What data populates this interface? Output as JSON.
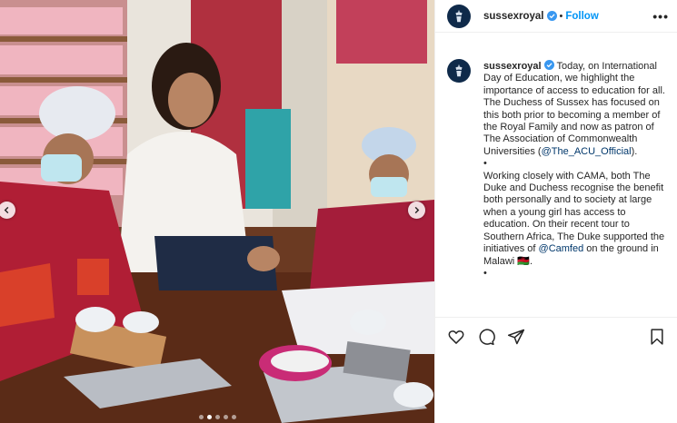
{
  "post": {
    "account": "sussexroyal",
    "follow_label": "Follow",
    "more_glyph": "•••",
    "separator": "•",
    "verified_icon": "verified-badge-icon",
    "accent_color": "#0095f6"
  },
  "caption": {
    "username": "sussexroyal",
    "p1_before": " Today, on International Day of Education, we highlight the importance of access to education for all. The Duchess of Sussex has focused on this both prior to becoming a member of the Royal Family and now as patron of The Association of Commonwealth Universities (",
    "p1_mention": "@The_ACU_Official",
    "p1_after": ").",
    "divider": "•",
    "p2_before": "Working closely with CAMA, both The Duke and Duchess recognise the benefit both personally and to society at large when a young girl has access to education. On their recent tour to Southern Africa, The Duke supported the initiatives of ",
    "p2_mention": "@Camfed",
    "p2_after": " on the ground in Malawi 🇲🇼.",
    "divider2": "•"
  },
  "actions": {
    "like": "heart-icon",
    "comment": "comment-icon",
    "share": "share-icon",
    "save": "bookmark-icon"
  },
  "carousel": {
    "total": 5,
    "active": 1
  }
}
